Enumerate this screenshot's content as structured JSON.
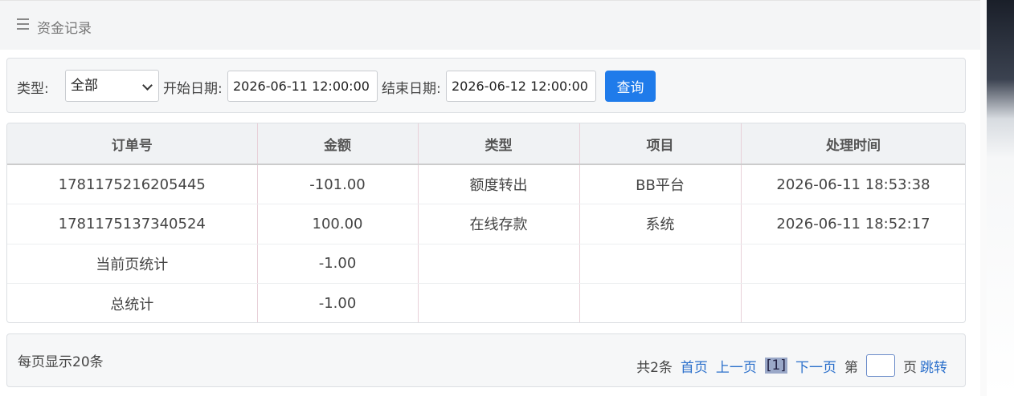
{
  "header": {
    "title": "资金记录",
    "menu_icon": "menu-icon"
  },
  "filter": {
    "type_label": "类型:",
    "type_value": "全部",
    "start_label": "开始日期:",
    "start_value": "2026-06-11 12:00:00",
    "end_label": "结束日期:",
    "end_value": "2026-06-12 12:00:00",
    "query_label": "查询"
  },
  "table": {
    "headers": [
      "订单号",
      "金额",
      "类型",
      "项目",
      "处理时间"
    ],
    "rows": [
      [
        "1781175216205445",
        "-101.00",
        "额度转出",
        "BB平台",
        "2026-06-11 18:53:38"
      ],
      [
        "1781175137340524",
        "100.00",
        "在线存款",
        "系统",
        "2026-06-11 18:52:17"
      ],
      [
        "当前页统计",
        "-1.00",
        "",
        "",
        ""
      ],
      [
        "总统计",
        "-1.00",
        "",
        "",
        ""
      ]
    ]
  },
  "pager": {
    "per_page": "每页显示20条",
    "total": "共2条",
    "first": "首页",
    "prev": "上一页",
    "current": "[1]",
    "next": "下一页",
    "goto_prefix": "第",
    "goto_suffix": "页",
    "jump": "跳转"
  }
}
